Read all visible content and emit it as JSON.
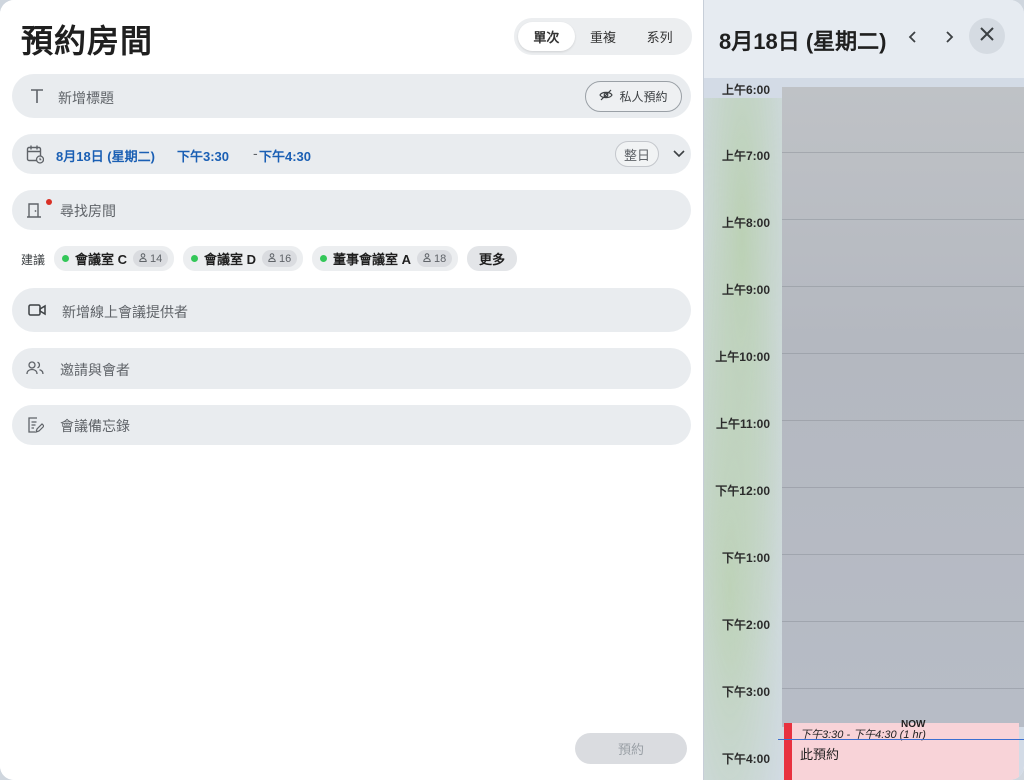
{
  "dialog": {
    "title": "預約房間",
    "recurrence_tabs": [
      "單次",
      "重複",
      "系列"
    ],
    "active_tab": 0
  },
  "title_field": {
    "placeholder": "新增標題",
    "private_label": "私人預約"
  },
  "time_field": {
    "date": "8月18日 (星期二)",
    "start": "下午3:30",
    "separator": "-",
    "end": "下午4:30",
    "all_day_label": "整日"
  },
  "room_field": {
    "placeholder": "尋找房間"
  },
  "suggestions": {
    "label": "建議",
    "rooms": [
      {
        "name": "會議室 C",
        "capacity": "14"
      },
      {
        "name": "會議室 D",
        "capacity": "16"
      },
      {
        "name": "董事會議室 A",
        "capacity": "18"
      }
    ],
    "more_label": "更多"
  },
  "online_field": {
    "placeholder": "新增線上會議提供者"
  },
  "invite_field": {
    "placeholder": "邀請與會者"
  },
  "notes_field": {
    "placeholder": "會議備忘錄"
  },
  "submit_label": "預約",
  "calendar": {
    "date": "8月18日 (星期二)",
    "times": [
      "上午6:00",
      "上午7:00",
      "上午8:00",
      "上午9:00",
      "上午10:00",
      "上午11:00",
      "下午12:00",
      "下午1:00",
      "下午2:00",
      "下午3:00",
      "下午4:00"
    ],
    "now_label": "NOW",
    "event": {
      "time": "下午3:30 - 下午4:30 (1 hr)",
      "title": "此預約"
    }
  },
  "colors": {
    "accent": "#1a5fb4",
    "available": "#34c759",
    "event_bar": "#e8313f",
    "event_bg": "#f8d3d8",
    "now_line": "#3b6fd1"
  }
}
